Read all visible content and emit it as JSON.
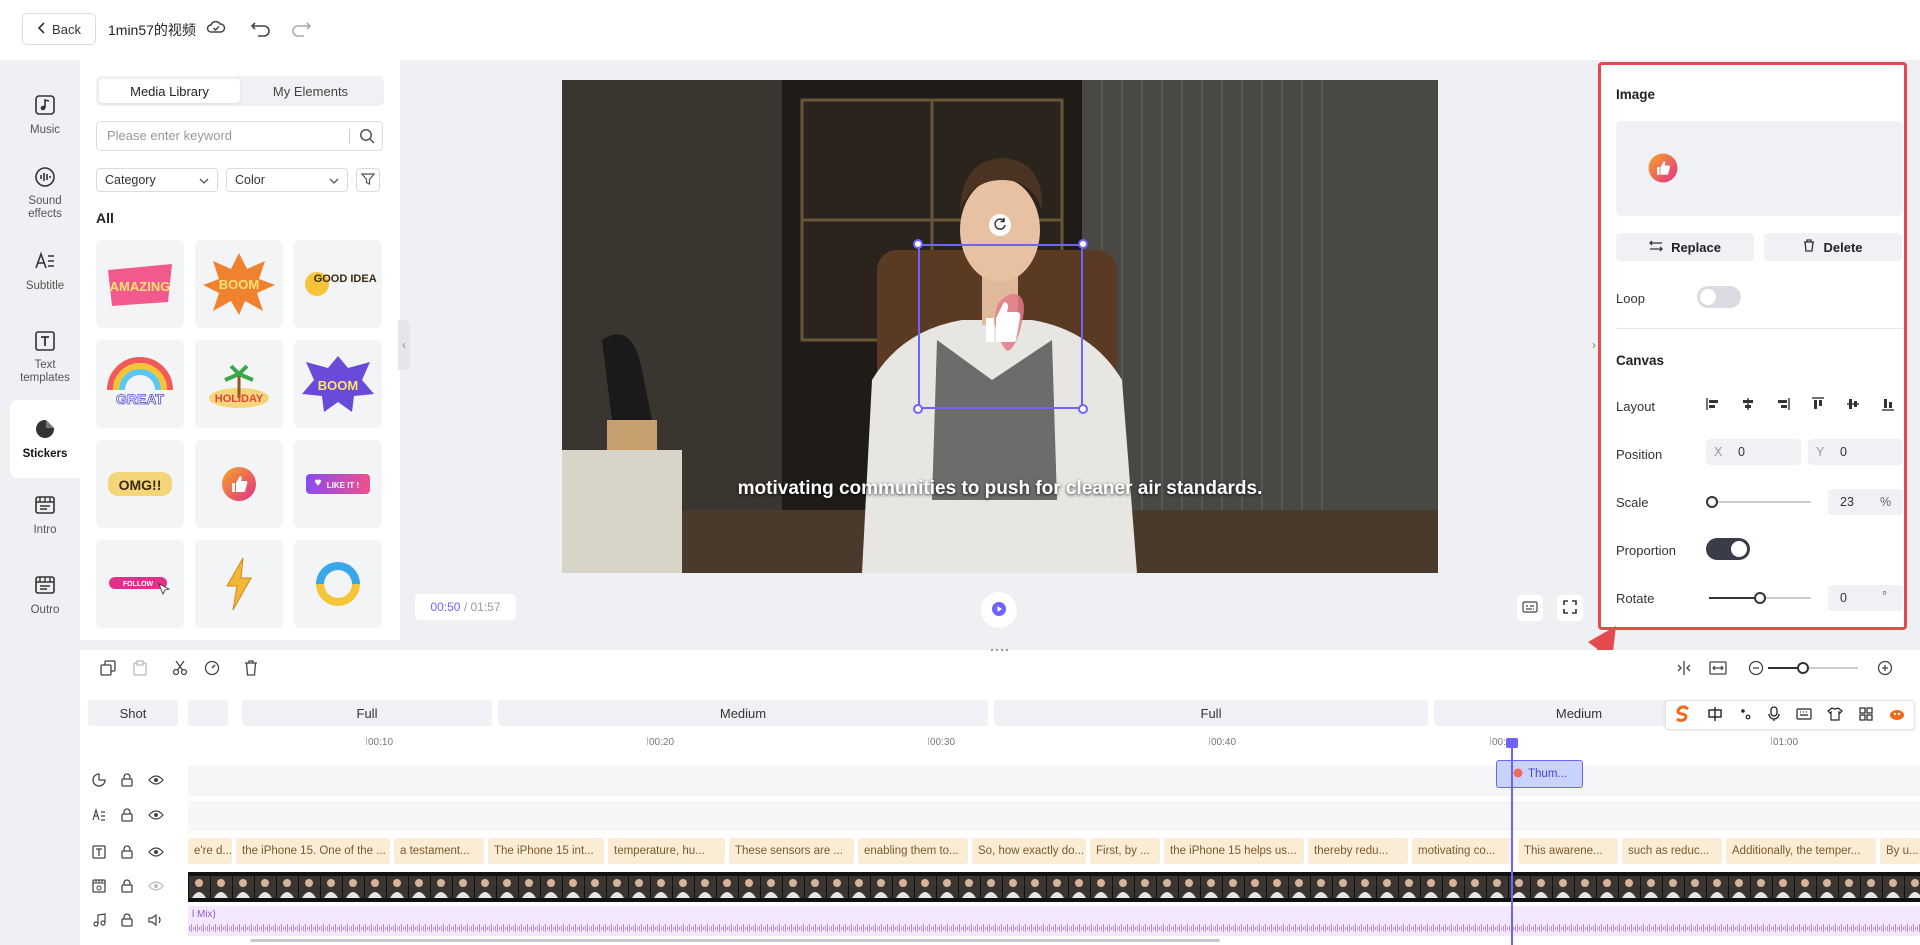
{
  "header": {
    "back_label": "Back",
    "project_title": "1min57的视频"
  },
  "nav": {
    "items": [
      {
        "label": "Music",
        "icon": "music-icon"
      },
      {
        "label": "Sound effects",
        "icon": "sound-effects-icon"
      },
      {
        "label": "Subtitle",
        "icon": "subtitle-icon"
      },
      {
        "label": "Text templates",
        "icon": "text-template-icon"
      },
      {
        "label": "Stickers",
        "icon": "sticker-icon",
        "active": true
      },
      {
        "label": "Intro",
        "icon": "intro-icon"
      },
      {
        "label": "Outro",
        "icon": "outro-icon"
      }
    ]
  },
  "media": {
    "tabs": [
      "Media Library",
      "My Elements"
    ],
    "active_tab": "Media Library",
    "search_placeholder": "Please enter keyword",
    "category_label": "Category",
    "color_label": "Color",
    "section_label": "All",
    "stickers": [
      {
        "name": "amazing-sticker",
        "text": "AMAZING"
      },
      {
        "name": "boom-sticker",
        "text": "BOOM"
      },
      {
        "name": "good-idea-sticker",
        "text": "GOOD IDEA!"
      },
      {
        "name": "great-sticker",
        "text": "GREAT"
      },
      {
        "name": "holiday-sticker",
        "text": "HOLIDAY"
      },
      {
        "name": "boom-purple-sticker",
        "text": "BOOM"
      },
      {
        "name": "omg-sticker",
        "text": "OMG!!"
      },
      {
        "name": "thumbs-up-sticker",
        "text": ""
      },
      {
        "name": "like-it-sticker",
        "text": "LIKE IT !"
      },
      {
        "name": "follow-sticker",
        "text": "FOLLOW"
      },
      {
        "name": "lightning-sticker",
        "text": ""
      },
      {
        "name": "swirl-sticker",
        "text": ""
      }
    ]
  },
  "preview": {
    "subtitle": "motivating communities to push for cleaner air standards.",
    "current_time": "00:50",
    "total_time": "01:57"
  },
  "props": {
    "image_title": "Image",
    "replace_label": "Replace",
    "delete_label": "Delete",
    "loop_label": "Loop",
    "loop_on": false,
    "canvas_title": "Canvas",
    "layout_label": "Layout",
    "position_label": "Position",
    "pos_x_axis": "X",
    "pos_x": "0",
    "pos_y_axis": "Y",
    "pos_y": "0",
    "scale_label": "Scale",
    "scale_value": "23",
    "scale_unit": "%",
    "proportion_label": "Proportion",
    "proportion_on": true,
    "rotate_label": "Rotate",
    "rotate_value": "0",
    "rotate_unit": "°"
  },
  "timeline": {
    "shot_label": "Shot",
    "shots": [
      "Full",
      "Medium",
      "Full",
      "Medium"
    ],
    "ruler": [
      "00:10",
      "00:20",
      "00:30",
      "00:40",
      "00:50",
      "01:00"
    ],
    "sticker_clip_label": "Thum...",
    "subtitles": [
      "e're d...",
      "the iPhone 15. One of the ...",
      "a testament...",
      "The iPhone 15 int...",
      "temperature, hu...",
      "These sensors are ...",
      "enabling them to...",
      "So, how exactly do...",
      "First, by ...",
      "the iPhone 15 helps us...",
      "thereby redu...",
      "motivating co...",
      "This awarene...",
      "such as reduc...",
      "Additionally, the temper...",
      "By u..."
    ],
    "audio_label": "l Mix)"
  },
  "colors": {
    "accent": "#6e63ff",
    "highlight_border": "#e5484d",
    "subtitle_chip": "#fbecd6",
    "audio_track": "#f0e4ff"
  }
}
